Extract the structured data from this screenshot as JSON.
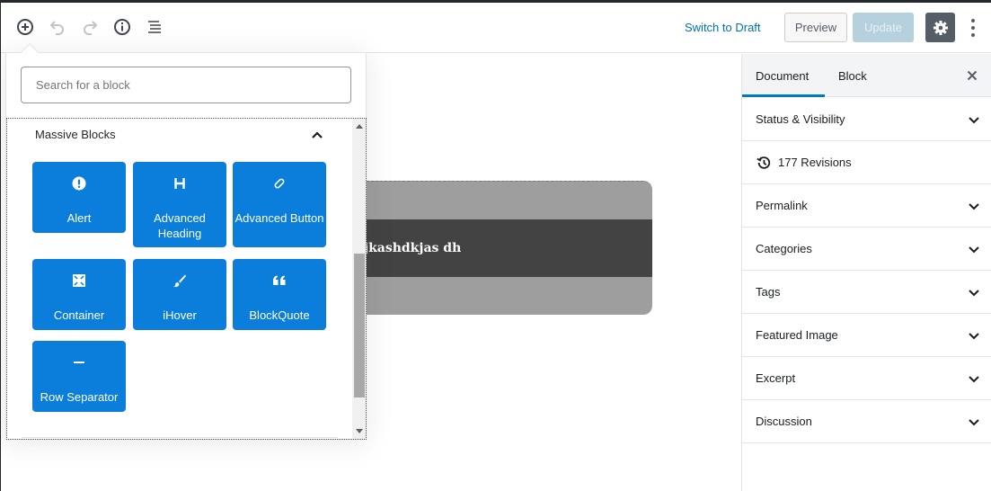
{
  "header": {
    "tools": [
      {
        "name": "add-block",
        "icon": "plus-circle-icon"
      },
      {
        "name": "undo",
        "icon": "undo-icon"
      },
      {
        "name": "redo",
        "icon": "redo-icon"
      },
      {
        "name": "info",
        "icon": "info-icon"
      },
      {
        "name": "outline",
        "icon": "list-view-icon"
      }
    ],
    "switch_to_draft": "Switch to Draft",
    "preview": "Preview",
    "update": "Update",
    "settings_icon": "gear-icon",
    "more_icon": "vertical-ellipsis-icon"
  },
  "inserter": {
    "search_placeholder": "Search for a block",
    "panel_title": "Massive Blocks",
    "blocks": [
      {
        "label": "Alert",
        "icon": "exclamation-circle-icon"
      },
      {
        "label": "Advanced Heading",
        "icon": "heading-h-icon"
      },
      {
        "label": "Advanced Button",
        "icon": "button-pill-icon"
      },
      {
        "label": "Container",
        "icon": "container-compress-icon"
      },
      {
        "label": "iHover",
        "icon": "paintbrush-icon"
      },
      {
        "label": "BlockQuote",
        "icon": "quote-icon"
      },
      {
        "label": "Row Separator",
        "icon": "minus-line-icon"
      }
    ]
  },
  "editor": {
    "block_text": "jkashdkjas dh"
  },
  "sidebar": {
    "tabs": [
      {
        "label": "Document",
        "active": true
      },
      {
        "label": "Block",
        "active": false
      }
    ],
    "revisions": "177 Revisions",
    "panels": [
      "Status & Visibility",
      "Permalink",
      "Categories",
      "Tags",
      "Featured Image",
      "Excerpt",
      "Discussion"
    ]
  },
  "colors": {
    "accent": "#0073aa",
    "block_button": "#0b7dda",
    "update_disabled": "#b5d1dd",
    "settings_active": "#555d66"
  }
}
